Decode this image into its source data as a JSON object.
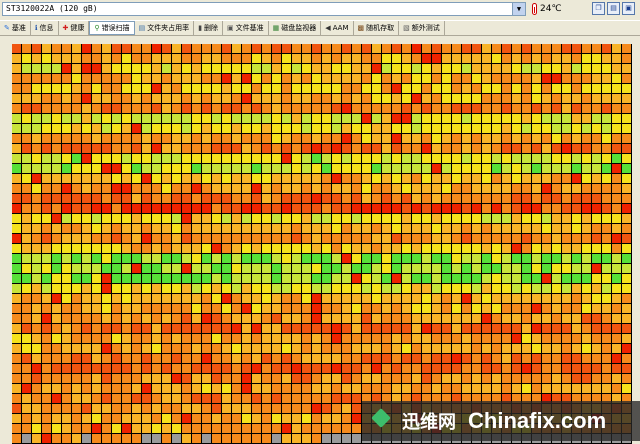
{
  "header": {
    "drive": "ST3120022A (120 gB)",
    "temperature": "24℃"
  },
  "tabs": [
    {
      "label": "基准",
      "icon": "benchmark-icon",
      "glyph": "✎",
      "color": "#2a6fdb",
      "active": false
    },
    {
      "label": "信息",
      "icon": "info-icon",
      "glyph": "ℹ",
      "color": "#1a4fa8",
      "active": false
    },
    {
      "label": "健康",
      "icon": "health-cross-icon",
      "glyph": "✚",
      "color": "#d21f1f",
      "active": false
    },
    {
      "label": "错误扫描",
      "icon": "error-scan-magnifier-icon",
      "glyph": "⚲",
      "color": "#2a8a2a",
      "active": true
    },
    {
      "label": "文件夹占用率",
      "icon": "folder-usage-icon",
      "glyph": "▤",
      "color": "#3a6ea5",
      "active": false
    },
    {
      "label": "删除",
      "icon": "erase-icon",
      "glyph": "▮",
      "color": "#444444",
      "active": false
    },
    {
      "label": "文件基准",
      "icon": "file-benchmark-icon",
      "glyph": "▣",
      "color": "#555555",
      "active": false
    },
    {
      "label": "磁盘监视器",
      "icon": "disk-monitor-icon",
      "glyph": "▦",
      "color": "#2c7d2c",
      "active": false
    },
    {
      "label": "AAM",
      "icon": "speaker-icon",
      "glyph": "◀",
      "color": "#333333",
      "active": false
    },
    {
      "label": "随机存取",
      "icon": "random-access-icon",
      "glyph": "▩",
      "color": "#7a4a1a",
      "active": false
    },
    {
      "label": "额外测试",
      "icon": "extra-tests-icon",
      "glyph": "▧",
      "color": "#5a5a5a",
      "active": false
    }
  ],
  "scan": {
    "cols": 62,
    "rows": 40,
    "scanned_blocks": 2480,
    "palette": {
      "red": "#ee2200",
      "orange_red": "#f05510",
      "orange": "#f58a1c",
      "amber": "#f8b428",
      "yellow": "#f5e21c",
      "yellow_green": "#c8e43a",
      "green": "#58e038",
      "gray": "#9a9a9a",
      "background": "#000000",
      "outline": "#000000"
    }
  },
  "watermark": {
    "cn": "迅维网",
    "en": "Chinafix.com"
  }
}
